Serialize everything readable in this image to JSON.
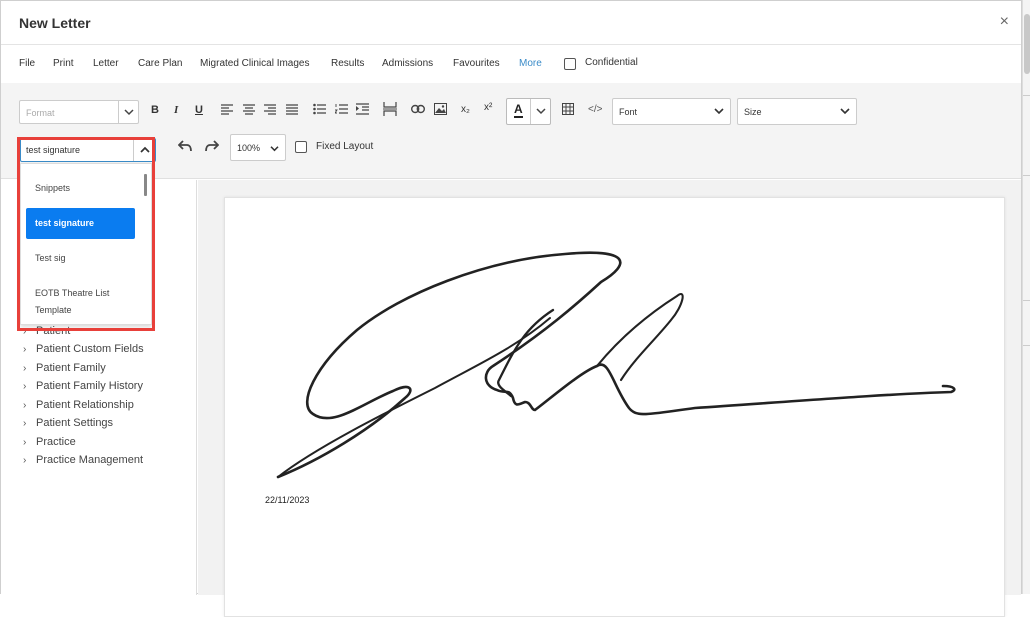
{
  "window": {
    "title": "New Letter",
    "close_label": "×"
  },
  "menu": {
    "items": [
      "File",
      "Print",
      "Letter",
      "Care Plan",
      "Migrated Clinical Images",
      "Results",
      "Admissions",
      "Favourites",
      "More"
    ],
    "confidential_label": "Confidential",
    "confidential_checked": false
  },
  "toolbar": {
    "format_placeholder": "Format",
    "bold": "B",
    "italic": "I",
    "underline": "U",
    "subscript": "x₂",
    "superscript": "x²",
    "font_color": "A",
    "source_code": "</>",
    "font_label": "Font",
    "size_label": "Size",
    "zoom": "100%",
    "fixed_layout_label": "Fixed Layout",
    "fixed_layout_checked": false
  },
  "snippets": {
    "selected_value": "test signature",
    "options": [
      "Snippets",
      "test signature",
      "Test sig",
      "EOTB Theatre List Template"
    ],
    "selected_index": 1
  },
  "tree": {
    "items": [
      "Patient",
      "Patient Custom Fields",
      "Patient Family",
      "Patient Family History",
      "Patient Relationship",
      "Patient Settings",
      "Practice",
      "Practice Management"
    ]
  },
  "document": {
    "date": "22/11/2023"
  },
  "colors": {
    "accent": "#3a8bc8",
    "selected": "#0a7cf0",
    "highlight": "#e8403a"
  }
}
